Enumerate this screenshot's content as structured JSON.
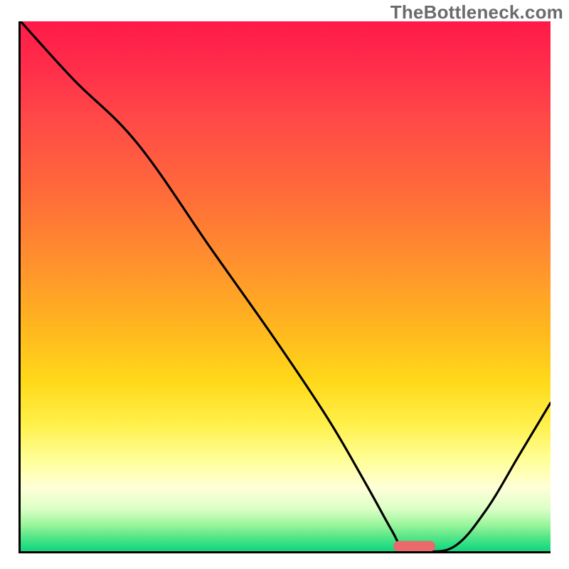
{
  "watermark": "TheBottleneck.com",
  "chart_data": {
    "type": "line",
    "title": "",
    "xlabel": "",
    "ylabel": "",
    "xlim": [
      0,
      100
    ],
    "ylim": [
      0,
      100
    ],
    "x": [
      0,
      10,
      22,
      36,
      48,
      58,
      65,
      70,
      72,
      76,
      82,
      88,
      94,
      100
    ],
    "values": [
      100,
      89,
      77,
      57,
      40,
      25,
      13,
      4,
      1,
      0,
      1,
      8,
      18,
      28
    ],
    "ideal_range_x": [
      70,
      78
    ],
    "curve_color": "#000000",
    "marker_color": "#e86a6a",
    "gradient_stops": [
      {
        "pct": 0,
        "color": "#ff1a48"
      },
      {
        "pct": 45,
        "color": "#ff8f2e"
      },
      {
        "pct": 76,
        "color": "#fff04a"
      },
      {
        "pct": 92,
        "color": "#dcffc7"
      },
      {
        "pct": 100,
        "color": "#16d37d"
      }
    ]
  }
}
